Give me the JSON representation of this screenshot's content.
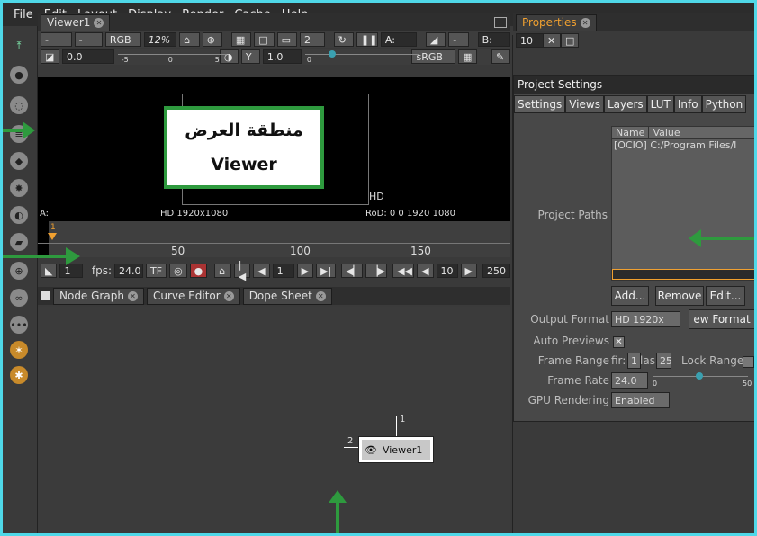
{
  "menu": [
    "File",
    "Edit",
    "Layout",
    "Display",
    "Render",
    "Cache",
    "Help"
  ],
  "viewer_tab": "Viewer1",
  "viewer_controls": {
    "channels": "RGB",
    "zoom": "12%",
    "proxy": "2",
    "input_a": "A:",
    "input_b": "B:",
    "gain": "0.0",
    "gamma_label": "Y",
    "gamma": "1.0",
    "colorspace": "sRGB",
    "ruler_ticks": [
      "-5",
      "0",
      "5",
      "0"
    ]
  },
  "callout": {
    "line1": "منطقة العرض",
    "line2": "Viewer"
  },
  "viewer_labels": {
    "format": "HD 1920x1080",
    "format_short": "HD",
    "rod": "RoD: 0 0 1920 1080",
    "a_label": "A:"
  },
  "timeline": {
    "current": "1",
    "ticks": [
      "50",
      "100",
      "150"
    ]
  },
  "playback": {
    "frame": "1",
    "fps_label": "fps:",
    "fps": "24.0",
    "tf": "TF",
    "step": "1",
    "incr": "10",
    "end": "250"
  },
  "bottom_tabs": [
    "Node Graph",
    "Curve Editor",
    "Dope Sheet"
  ],
  "node": {
    "label": "Viewer1",
    "input1": "1",
    "input2": "2"
  },
  "properties": {
    "tab": "Properties",
    "max_panels": "10",
    "title": "Project Settings",
    "tabs": [
      "Settings",
      "Views",
      "Layers",
      "LUT",
      "Info",
      "Python"
    ],
    "list_headers": [
      "Name",
      "Value"
    ],
    "list_row": "[OCIO] C:/Program Files/I",
    "project_paths_label": "Project Paths",
    "buttons": [
      "Add...",
      "Remove",
      "Edit..."
    ],
    "output_format_label": "Output Format",
    "output_format": "HD 1920x",
    "new_format": "ew Format",
    "auto_previews_label": "Auto Previews",
    "frame_range_label": "Frame Range",
    "first_label": "fir:",
    "first_value": "1",
    "last_label": "las",
    "last_value": "25",
    "lock_range_label": "Lock Range",
    "frame_rate_label": "Frame Rate",
    "frame_rate": "24.0",
    "slider_min": "0",
    "slider_max": "50",
    "gpu_label": "GPU Rendering",
    "gpu_value": "Enabled"
  },
  "colors": {
    "accent": "#f0a030",
    "callout_border": "#2e9a3e",
    "frame_border": "#4fd8e8",
    "arrow": "#2e9a3e"
  }
}
